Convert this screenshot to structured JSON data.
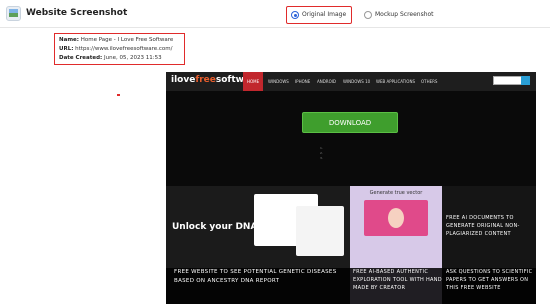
{
  "header": {
    "app_title": "Website Screenshot",
    "radio_original": "Original Image",
    "radio_mockup": "Mockup Screenshot",
    "selected": "original"
  },
  "meta": {
    "name_label": "Name:",
    "name_value": "Home Page - I Love Free Software",
    "url_label": "URL:",
    "url_value": "https://www.ilovefreesoftware.com/",
    "date_label": "Date Created:",
    "date_value": "June, 05, 2023 11:53"
  },
  "site": {
    "logo_main": "ilove",
    "logo_accent": "free",
    "logo_end": "software",
    "nav": [
      "HOME",
      "WINDOWS",
      "IPHONE",
      "ANDROID",
      "WINDOWS 10",
      "WEB APPLICATIONS",
      "OTHERS"
    ],
    "download_label": "DOWNLOAD",
    "cards": {
      "dna_title": "Unlock your DNA",
      "card1_caption": "FREE WEBSITE TO SEE POTENTIAL GENETIC DISEASES BASED ON ANCESTRY DNA REPORT",
      "card2_header": "Generate true vector",
      "card2_caption": "FREE AI-BASED AUTHENTIC EXPLORATION TOOL WITH HAND MADE BY CREATOR",
      "card3_caption_top": "FREE AI DOCUMENTS TO GENERATE ORIGINAL NON-PLAGIARIZED CONTENT",
      "card3_caption": "ASK QUESTIONS TO SCIENTIFIC PAPERS TO GET ANSWERS ON THIS FREE WEBSITE"
    }
  },
  "colors": {
    "accent_red": "#e02b2b",
    "radio_blue": "#2b62d9",
    "download_green": "#3f9e2d",
    "nav_home": "#c1272d"
  }
}
